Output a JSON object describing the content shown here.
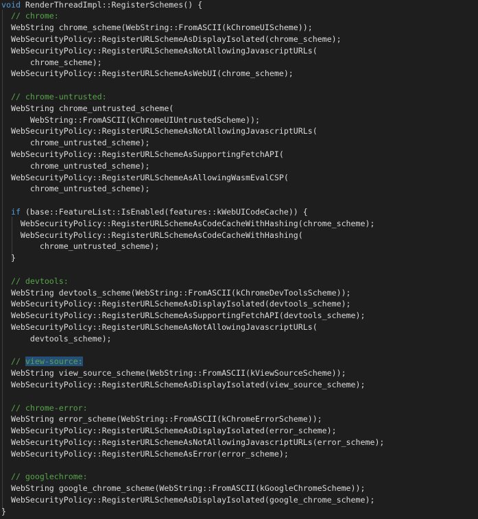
{
  "editor": {
    "lines": [
      [
        {
          "t": "kw",
          "v": "void"
        },
        {
          "t": "tx",
          "v": " RenderThreadImpl::RegisterSchemes() {"
        }
      ],
      [
        {
          "t": "cm",
          "v": "  // chrome:"
        }
      ],
      [
        {
          "t": "tx",
          "v": "  WebString chrome_scheme(WebString::FromASCII(kChromeUIScheme));"
        }
      ],
      [
        {
          "t": "tx",
          "v": "  WebSecurityPolicy::RegisterURLSchemeAsDisplayIsolated(chrome_scheme);"
        }
      ],
      [
        {
          "t": "tx",
          "v": "  WebSecurityPolicy::RegisterURLSchemeAsNotAllowingJavascriptURLs("
        }
      ],
      [
        {
          "t": "tx",
          "v": "      chrome_scheme);"
        }
      ],
      [
        {
          "t": "tx",
          "v": "  WebSecurityPolicy::RegisterURLSchemeAsWebUI(chrome_scheme);"
        }
      ],
      [],
      [
        {
          "t": "cm",
          "v": "  // chrome-untrusted:"
        }
      ],
      [
        {
          "t": "tx",
          "v": "  WebString chrome_untrusted_scheme("
        }
      ],
      [
        {
          "t": "tx",
          "v": "      WebString::FromASCII(kChromeUIUntrustedScheme));"
        }
      ],
      [
        {
          "t": "tx",
          "v": "  WebSecurityPolicy::RegisterURLSchemeAsNotAllowingJavascriptURLs("
        }
      ],
      [
        {
          "t": "tx",
          "v": "      chrome_untrusted_scheme);"
        }
      ],
      [
        {
          "t": "tx",
          "v": "  WebSecurityPolicy::RegisterURLSchemeAsSupportingFetchAPI("
        }
      ],
      [
        {
          "t": "tx",
          "v": "      chrome_untrusted_scheme);"
        }
      ],
      [
        {
          "t": "tx",
          "v": "  WebSecurityPolicy::RegisterURLSchemeAsAllowingWasmEvalCSP("
        }
      ],
      [
        {
          "t": "tx",
          "v": "      chrome_untrusted_scheme);"
        }
      ],
      [],
      [
        {
          "t": "tx",
          "v": "  "
        },
        {
          "t": "kw",
          "v": "if"
        },
        {
          "t": "tx",
          "v": " (base::FeatureList::IsEnabled(features::kWebUICodeCache)) {"
        }
      ],
      [
        {
          "t": "tx",
          "v": "    WebSecurityPolicy::RegisterURLSchemeAsCodeCacheWithHashing(chrome_scheme);"
        }
      ],
      [
        {
          "t": "tx",
          "v": "    WebSecurityPolicy::RegisterURLSchemeAsCodeCacheWithHashing("
        }
      ],
      [
        {
          "t": "tx",
          "v": "        chrome_untrusted_scheme);"
        }
      ],
      [
        {
          "t": "tx",
          "v": "  }"
        }
      ],
      [],
      [
        {
          "t": "cm",
          "v": "  // devtools:"
        }
      ],
      [
        {
          "t": "tx",
          "v": "  WebString devtools_scheme(WebString::FromASCII(kChromeDevToolsScheme));"
        }
      ],
      [
        {
          "t": "tx",
          "v": "  WebSecurityPolicy::RegisterURLSchemeAsDisplayIsolated(devtools_scheme);"
        }
      ],
      [
        {
          "t": "tx",
          "v": "  WebSecurityPolicy::RegisterURLSchemeAsSupportingFetchAPI(devtools_scheme);"
        }
      ],
      [
        {
          "t": "tx",
          "v": "  WebSecurityPolicy::RegisterURLSchemeAsNotAllowingJavascriptURLs("
        }
      ],
      [
        {
          "t": "tx",
          "v": "      devtools_scheme);"
        }
      ],
      [],
      [
        {
          "t": "cm",
          "v": "  // "
        },
        {
          "t": "hl",
          "v": "view-source:"
        }
      ],
      [
        {
          "t": "tx",
          "v": "  WebString view_source_scheme(WebString::FromASCII(kViewSourceScheme));"
        }
      ],
      [
        {
          "t": "tx",
          "v": "  WebSecurityPolicy::RegisterURLSchemeAsDisplayIsolated(view_source_scheme);"
        }
      ],
      [],
      [
        {
          "t": "cm",
          "v": "  // chrome-error:"
        }
      ],
      [
        {
          "t": "tx",
          "v": "  WebString error_scheme(WebString::FromASCII(kChromeErrorScheme));"
        }
      ],
      [
        {
          "t": "tx",
          "v": "  WebSecurityPolicy::RegisterURLSchemeAsDisplayIsolated(error_scheme);"
        }
      ],
      [
        {
          "t": "tx",
          "v": "  WebSecurityPolicy::RegisterURLSchemeAsNotAllowingJavascriptURLs(error_scheme);"
        }
      ],
      [
        {
          "t": "tx",
          "v": "  WebSecurityPolicy::RegisterURLSchemeAsError(error_scheme);"
        }
      ],
      [],
      [
        {
          "t": "cm",
          "v": "  // googlechrome:"
        }
      ],
      [
        {
          "t": "tx",
          "v": "  WebString google_chrome_scheme(WebString::FromASCII(kGoogleChromeScheme));"
        }
      ],
      [
        {
          "t": "tx",
          "v": "  WebSecurityPolicy::RegisterURLSchemeAsDisplayIsolated(google_chrome_scheme);"
        }
      ],
      [
        {
          "t": "tx",
          "v": "}"
        }
      ]
    ]
  },
  "colors": {
    "background": "#1e1e1e",
    "text": "#dcdcdc",
    "keyword": "#569cd6",
    "comment": "#57a64a",
    "selection": "#264f78",
    "indent_guide": "#404040"
  }
}
